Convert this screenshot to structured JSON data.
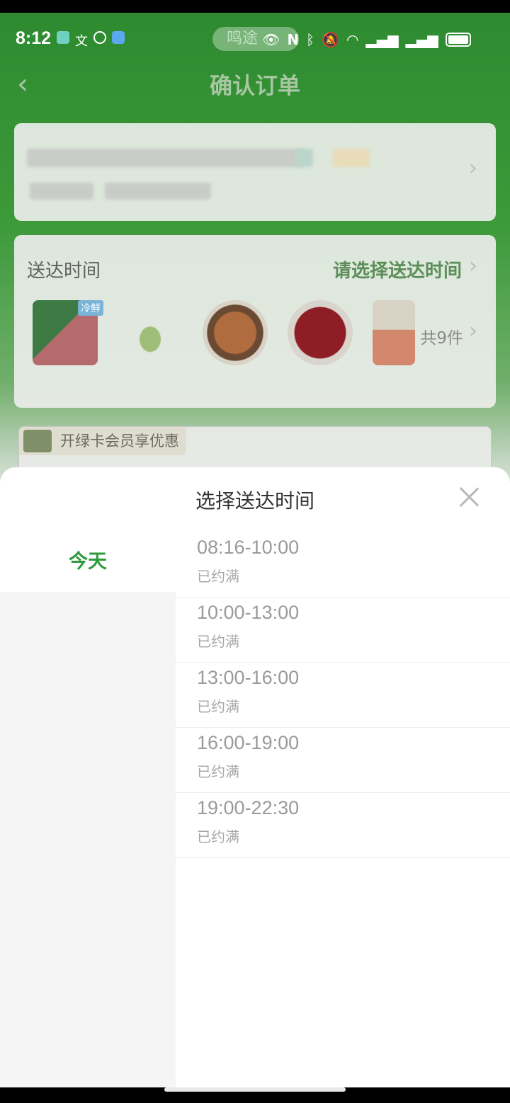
{
  "status_bar": {
    "time": "8:12",
    "pill_text": "鸣途"
  },
  "nav": {
    "back_glyph": "‹",
    "title": "确认订单"
  },
  "delivery": {
    "label": "送达时间",
    "choose": "请选择送达时间",
    "count": "共9件",
    "thumb_labels": [
      "冷鲜",
      "",
      "",
      "",
      ""
    ]
  },
  "member": {
    "text": "开绿卡会员享优惠"
  },
  "sheet": {
    "title": "选择送达时间",
    "days": [
      {
        "label": "今天",
        "selected": true
      }
    ],
    "slots": [
      {
        "range": "08:16-10:00",
        "status": "已约满"
      },
      {
        "range": "10:00-13:00",
        "status": "已约满"
      },
      {
        "range": "13:00-16:00",
        "status": "已约满"
      },
      {
        "range": "16:00-19:00",
        "status": "已约满"
      },
      {
        "range": "19:00-22:30",
        "status": "已约满"
      }
    ]
  },
  "colors": {
    "accent_green": "#2f9a3b",
    "header_green": "#2e8a2f"
  }
}
